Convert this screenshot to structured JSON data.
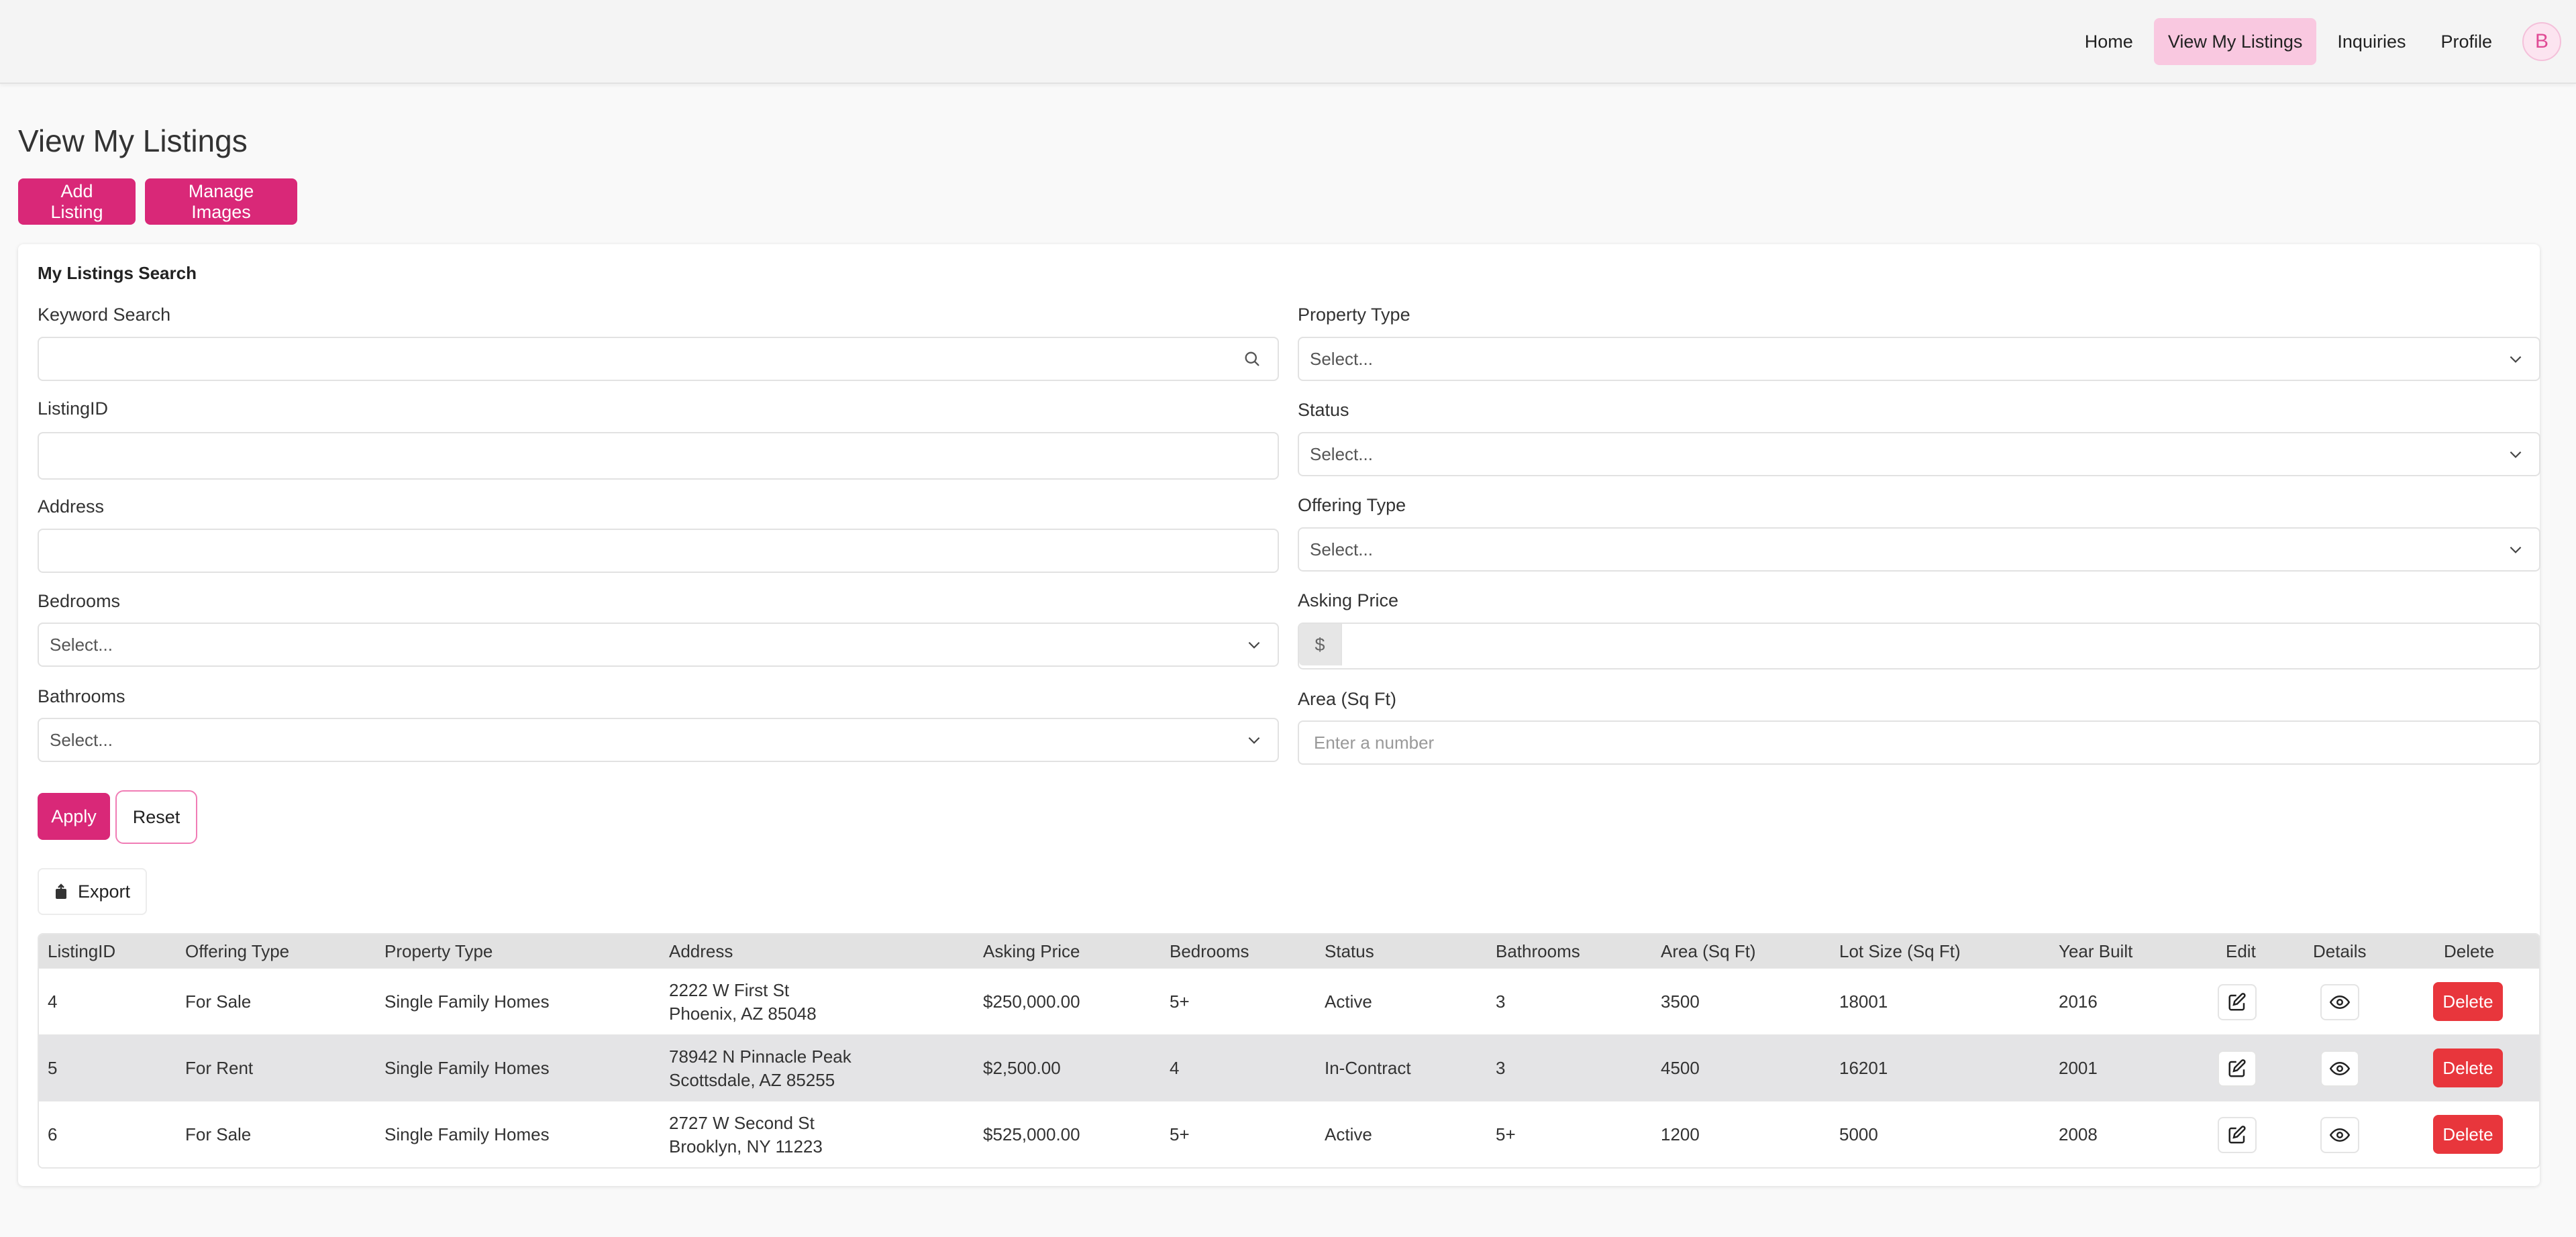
{
  "nav": {
    "items": [
      {
        "label": "Home",
        "active": false
      },
      {
        "label": "View My Listings",
        "active": true
      },
      {
        "label": "Inquiries",
        "active": false
      },
      {
        "label": "Profile",
        "active": false
      }
    ],
    "avatar": "B"
  },
  "page": {
    "title": "View My Listings",
    "add_listing_label": "Add Listing",
    "manage_images_label": "Manage Images"
  },
  "search": {
    "title": "My Listings Search",
    "keyword_label": "Keyword Search",
    "keyword_value": "",
    "listing_id_label": "ListingID",
    "listing_id_value": "",
    "address_label": "Address",
    "address_value": "",
    "bedrooms_label": "Bedrooms",
    "bedrooms_value": "Select...",
    "bathrooms_label": "Bathrooms",
    "bathrooms_value": "Select...",
    "property_type_label": "Property Type",
    "property_type_value": "Select...",
    "status_label": "Status",
    "status_value": "Select...",
    "offering_type_label": "Offering Type",
    "offering_type_value": "Select...",
    "asking_price_label": "Asking Price",
    "currency_symbol": "$",
    "asking_price_value": "",
    "area_label": "Area (Sq Ft)",
    "area_placeholder": "Enter a number",
    "apply_label": "Apply",
    "reset_label": "Reset",
    "export_label": "Export"
  },
  "table": {
    "headers": [
      "ListingID",
      "Offering Type",
      "Property Type",
      "Address",
      "Asking Price",
      "Bedrooms",
      "Status",
      "Bathrooms",
      "Area (Sq Ft)",
      "Lot Size (Sq Ft)",
      "Year Built",
      "Edit",
      "Details",
      "Delete"
    ],
    "rows": [
      {
        "id": "4",
        "offering": "For Sale",
        "property": "Single Family Homes",
        "address1": "2222 W First St",
        "address2": "Phoenix, AZ 85048",
        "price": "$250,000.00",
        "bedrooms": "5+",
        "status": "Active",
        "bathrooms": "3",
        "area": "3500",
        "lot": "18001",
        "year": "2016",
        "delete_label": "Delete"
      },
      {
        "id": "5",
        "offering": "For Rent",
        "property": "Single Family Homes",
        "address1": "78942 N Pinnacle Peak",
        "address2": "Scottsdale, AZ 85255",
        "price": "$2,500.00",
        "bedrooms": "4",
        "status": "In-Contract",
        "bathrooms": "3",
        "area": "4500",
        "lot": "16201",
        "year": "2001",
        "delete_label": "Delete"
      },
      {
        "id": "6",
        "offering": "For Sale",
        "property": "Single Family Homes",
        "address1": "2727 W Second St",
        "address2": "Brooklyn, NY 11223",
        "price": "$525,000.00",
        "bedrooms": "5+",
        "status": "Active",
        "bathrooms": "5+",
        "area": "1200",
        "lot": "5000",
        "year": "2008",
        "delete_label": "Delete"
      }
    ]
  },
  "colors": {
    "accent": "#d92878",
    "nav_active": "#f9c8e0",
    "delete": "#e8363c"
  },
  "icons": {
    "search": "search-icon",
    "chevron": "chevron-down-icon",
    "export": "export-icon",
    "edit": "edit-icon",
    "details": "eye-icon"
  }
}
